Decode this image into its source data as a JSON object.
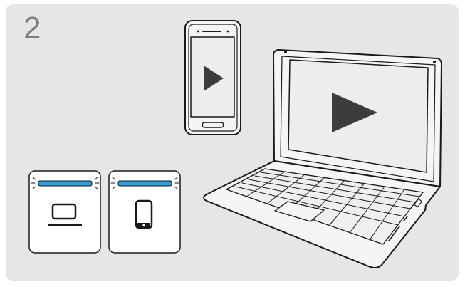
{
  "step": {
    "number": "2"
  },
  "icons": {
    "phone": "smartphone-icon",
    "laptop": "laptop-icon",
    "play_phone": "play-icon",
    "play_laptop": "play-icon",
    "indicator_laptop": "laptop-connection-indicator",
    "indicator_phone": "phone-connection-indicator"
  },
  "colors": {
    "panel_background": "#e6e6e6",
    "led_blue": "#2a9fd8",
    "outline": "#1a1a1a",
    "screen": "#ededed",
    "play": "#3c3c3c",
    "step_number": "#7d7d7d"
  }
}
